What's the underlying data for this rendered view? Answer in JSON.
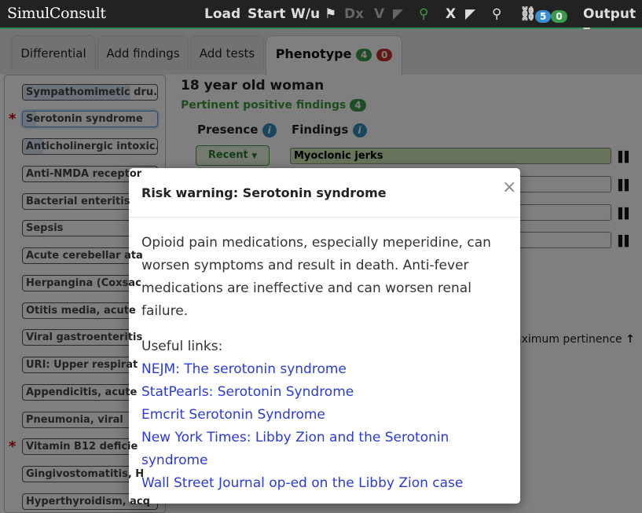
{
  "app": {
    "logo": "SimulConsult"
  },
  "topnav": {
    "load": "Load",
    "start": "Start",
    "wu": "W/u",
    "dx": "Dx",
    "v": "V",
    "x": "X",
    "badge_blue": "5",
    "badge_green": "0",
    "output": "Output"
  },
  "tabs": {
    "differential": "Differential",
    "add_findings": "Add findings",
    "add_tests": "Add tests",
    "phenotype": "Phenotype",
    "phenotype_green": "4",
    "phenotype_red": "0"
  },
  "sidebar": {
    "items": [
      "Sympathomimetic dru...",
      "Serotonin syndrome",
      "Anticholinergic intoxic...",
      "Anti-NMDA receptor",
      "Bacterial enteritis",
      "Sepsis",
      "Acute cerebellar ata",
      "Herpangina (Coxsac",
      "Otitis media, acute",
      "Viral gastroenteritis",
      "URI: Upper respirat",
      "Appendicitis, acute",
      "Pneumonia, viral",
      "Vitamin B12 deficie",
      "Gingivostomatitis, H",
      "Hyperthyroidism, acq"
    ]
  },
  "main": {
    "case_title": "18 year old woman",
    "pertinent_label": "Pertinent positive findings",
    "pertinent_count": "4",
    "presence_header": "Presence",
    "findings_header": "Findings",
    "presence_value": "Recent",
    "first_finding": "Myoclonic jerks",
    "max_pertinence": "aximum pertinence"
  },
  "modal": {
    "title": "Risk warning: Serotonin syndrome",
    "close": "×",
    "body": "Opioid pain medications, especially meperidine, can worsen symptoms and result in death. Anti-fever medications are ineffective and can worsen renal failure.",
    "links_label": "Useful links:",
    "links": [
      "NEJM: The serotonin syndrome",
      "StatPearls: Serotonin Syndrome",
      "Emcrit Serotonin Syndrome",
      "New York Times: Libby Zion and the Serotonin syndrome",
      "Wall Street Journal op-ed on the Libby Zion case"
    ]
  }
}
